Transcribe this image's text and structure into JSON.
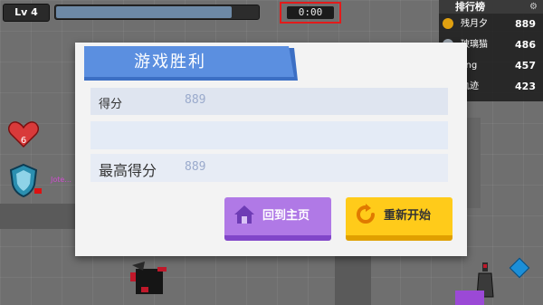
{
  "hud": {
    "level": "Lv 4",
    "xp_progress": 0.86,
    "timer": "0:00"
  },
  "leaderboard": {
    "title": "排行榜",
    "rows": [
      {
        "name": "残月夕",
        "score": "889",
        "rank_color": "#e0a010"
      },
      {
        "name": "玻璃猫",
        "score": "486",
        "rank_color": "#9aa3ad"
      },
      {
        "name": "ling",
        "score": "457",
        "rank_color": "#a86b2d"
      },
      {
        "name": "轨迹",
        "score": "423",
        "rank_color": "#555555"
      }
    ]
  },
  "scene": {
    "heart_count": "6",
    "ghost_name": "Jote..."
  },
  "dialog": {
    "title": "游戏胜利",
    "score_label": "得分",
    "score_value": "889",
    "best_label": "最高得分",
    "best_value": "889",
    "home_button": "回到主页",
    "restart_button": "重新开始"
  },
  "colors": {
    "banner": "#5b8fe0",
    "home_button": "#b079e6",
    "restart_button": "#ffcb1a",
    "timer_highlight": "#e21b1b"
  }
}
